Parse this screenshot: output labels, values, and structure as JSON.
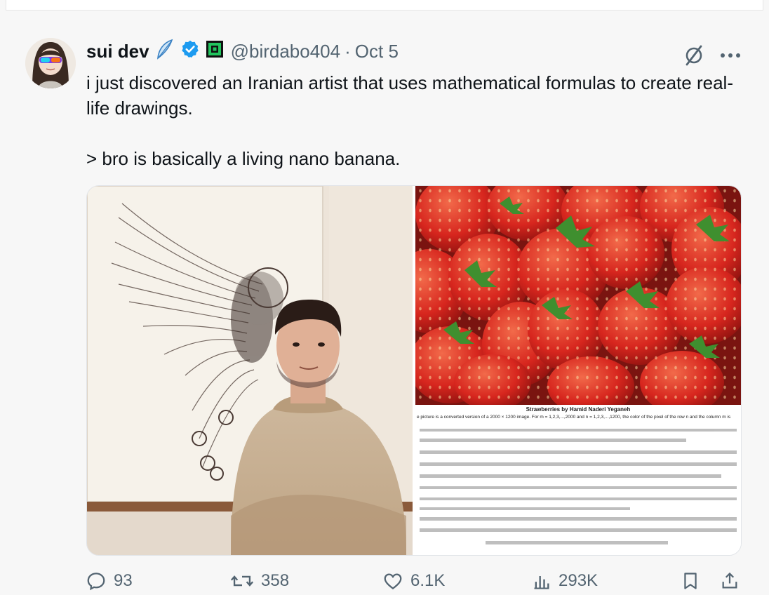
{
  "author": {
    "name": "sui dev",
    "handle": "@birdabo404",
    "separator": "·",
    "date": "Oct 5"
  },
  "tweet": {
    "line1": "i just discovered an Iranian artist that uses mathematical formulas to create real-life drawings.",
    "line2": "> bro is basically a living nano banana."
  },
  "media": {
    "right_title": "Strawberries by Hamid Naderi Yeganeh",
    "right_caption": "e picture is a converted version of a 2000 × 1200 image. For m = 1,2,3,...,2000 and n = 1,2,3,...,1200, the color of the pixel of the row n and the column m is"
  },
  "stats": {
    "replies": "93",
    "reposts": "358",
    "likes": "6.1K",
    "views": "293K"
  },
  "icons": {
    "verified": "verified-badge-icon",
    "feather": "feather-emoji-icon",
    "affiliate": "green-affiliate-badge-icon",
    "grok": "grok-icon",
    "more": "more-icon",
    "reply": "reply-icon",
    "repost": "repost-icon",
    "like": "like-icon",
    "views": "views-icon",
    "bookmark": "bookmark-icon",
    "share": "share-icon"
  },
  "colors": {
    "verified": "#1d9bf0",
    "text": "#0f1419",
    "muted": "#536471",
    "strawberry": "#d7261e"
  }
}
